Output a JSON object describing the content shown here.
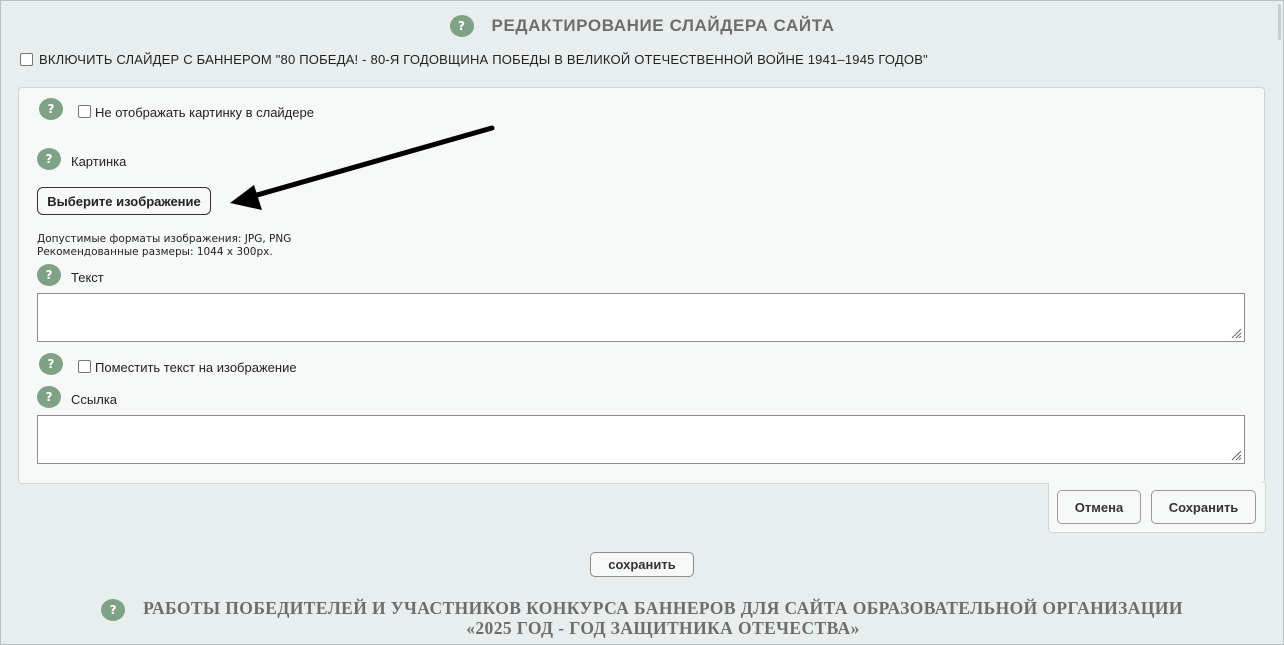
{
  "header": {
    "help_icon": "?",
    "title": "РЕДАКТИРОВАНИЕ СЛАЙДЕРА САЙТА"
  },
  "enable_slider": {
    "label": "ВКЛЮЧИТЬ СЛАЙДЕР С БАННЕРОМ \"80 ПОБЕДА! - 80-Я ГОДОВЩИНА ПОБЕДЫ В ВЕЛИКОЙ ОТЕЧЕСТВЕННОЙ ВОЙНЕ 1941–1945 ГОДОВ\"",
    "checked": false
  },
  "form": {
    "help_icon": "?",
    "hide_image_label": "Не отображать картинку в слайдере",
    "image_label": "Картинка",
    "choose_image_button": "Выберите изображение",
    "formats_hint": "Допустимые форматы изображения: JPG, PNG",
    "size_hint": "Рекомендованные размеры: 1044 x 300px.",
    "text_label": "Текст",
    "text_value": "",
    "overlay_text_label": "Поместить текст на изображение",
    "link_label": "Ссылка",
    "link_value": ""
  },
  "actions": {
    "cancel": "Отмена",
    "save": "Сохранить",
    "save_main": "сохранить"
  },
  "bottom_section": {
    "help_icon": "?",
    "title_line1": "РАБОТЫ ПОБЕДИТЕЛЕЙ И УЧАСТНИКОВ КОНКУРСА БАННЕРОВ ДЛЯ САЙТА ОБРАЗОВАТЕЛЬНОЙ ОРГАНИЗАЦИИ",
    "title_line2": "«2025 ГОД - ГОД ЗАЩИТНИКА ОТЕЧЕСТВА»"
  },
  "colors": {
    "background": "#e8eeee",
    "panel": "#f7f9f9",
    "help_badge": "#7fa186",
    "title_text": "#6d6d6d"
  }
}
